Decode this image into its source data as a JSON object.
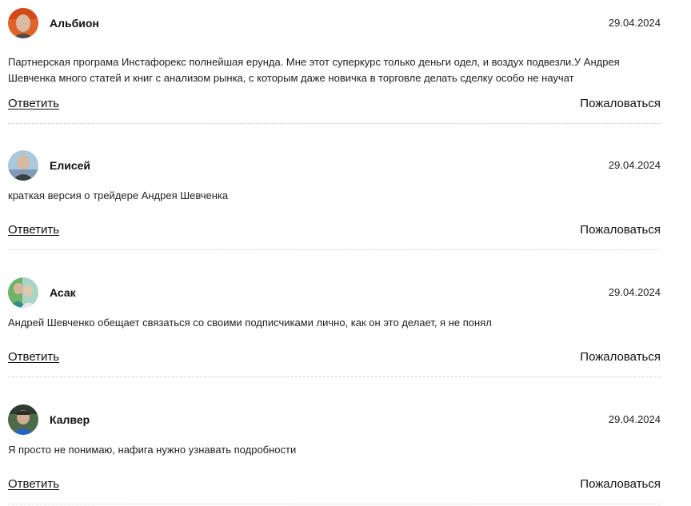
{
  "comments": [
    {
      "author": "Альбион",
      "date": "29.04.2024",
      "text": "Партнерская програма Инстафорекс полнейшая ерунда. Мне этот суперкурс только деньги одел, и воздух подвезли.У Андрея Шевченка много статей и книг с анализом рынка, с которым даже новичка в торговле делать сделку особо не научат",
      "reply_label": "Ответить",
      "report_label": "Пожаловаться"
    },
    {
      "author": "Елисей",
      "date": "29.04.2024",
      "text": "краткая версия о трейдере Андрея Шевченка",
      "reply_label": "Ответить",
      "report_label": "Пожаловаться"
    },
    {
      "author": "Асак",
      "date": "29.04.2024",
      "text": "Андрей Шевченко обещает связаться со своими подписчиками лично, как он это делает, я не понял",
      "reply_label": "Ответить",
      "report_label": "Пожаловаться"
    },
    {
      "author": "Калвер",
      "date": "29.04.2024",
      "text": "Я просто не понимаю, нафига нужно узнавать подробности",
      "reply_label": "Ответить",
      "report_label": "Пожаловаться"
    }
  ]
}
